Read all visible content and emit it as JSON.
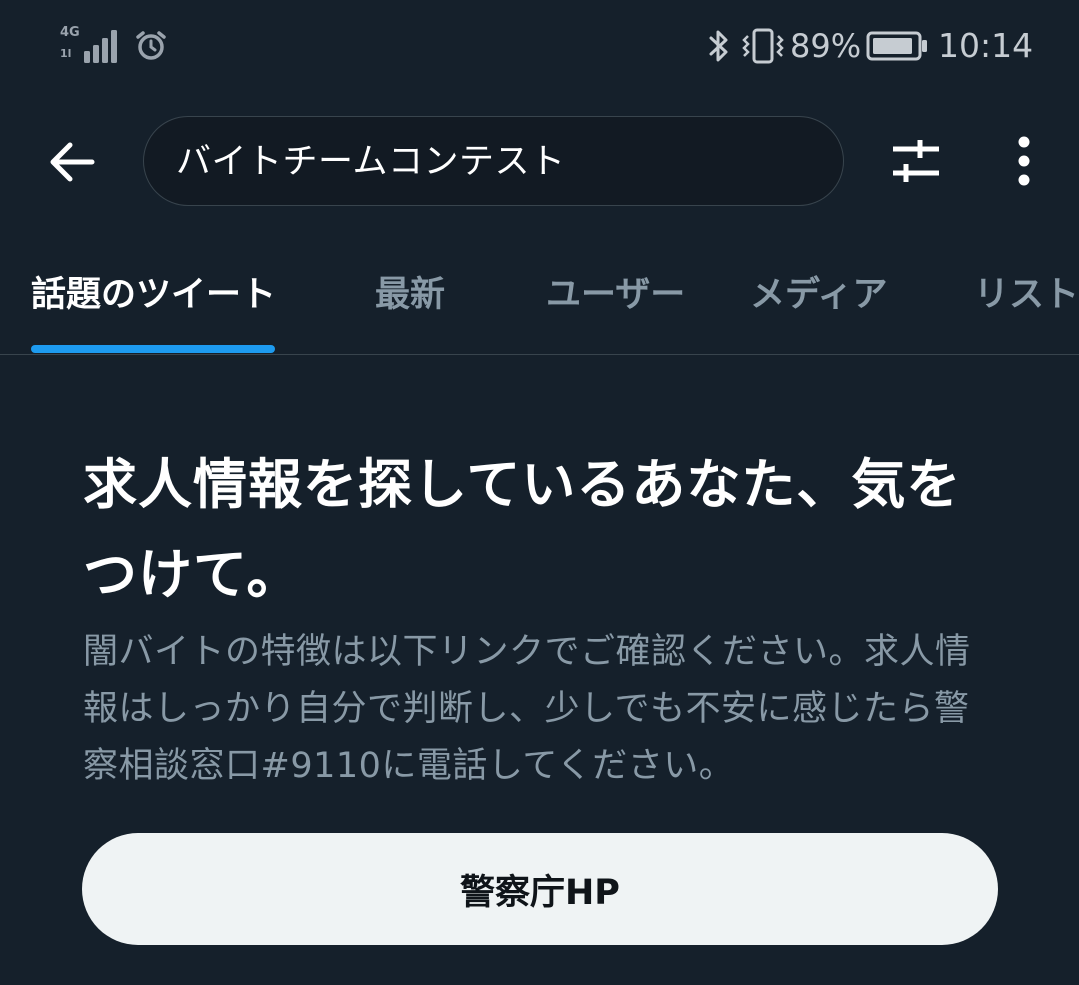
{
  "status_bar": {
    "network_type": "4G",
    "network_sub": "1l",
    "battery_percent": "89%",
    "time": "10:14",
    "icons": [
      "signal-icon",
      "alarm-icon",
      "bluetooth-icon",
      "vibrate-icon",
      "battery-icon"
    ]
  },
  "header": {
    "search_query": "バイトチームコンテスト",
    "icons": [
      "back-arrow-icon",
      "search-filter-icon",
      "more-vertical-icon"
    ]
  },
  "tabs": [
    {
      "label": "話題のツイート",
      "active": true
    },
    {
      "label": "最新",
      "active": false
    },
    {
      "label": "ユーザー",
      "active": false
    },
    {
      "label": "メディア",
      "active": false
    },
    {
      "label": "リスト",
      "active": false
    }
  ],
  "notice": {
    "title": "求人情報を探しているあなた、気をつけて。",
    "body": "闇バイトの特徴は以下リンクでご確認ください。求人情報はしっかり自分で判断し、少しでも不安に感じたら警察相談窓口#9110に電話してください。",
    "button_label": "警察庁HP"
  },
  "colors": {
    "background": "#15202b",
    "accent": "#1d9bf0",
    "muted_text": "#8899a6",
    "button_bg": "#eff3f4"
  }
}
